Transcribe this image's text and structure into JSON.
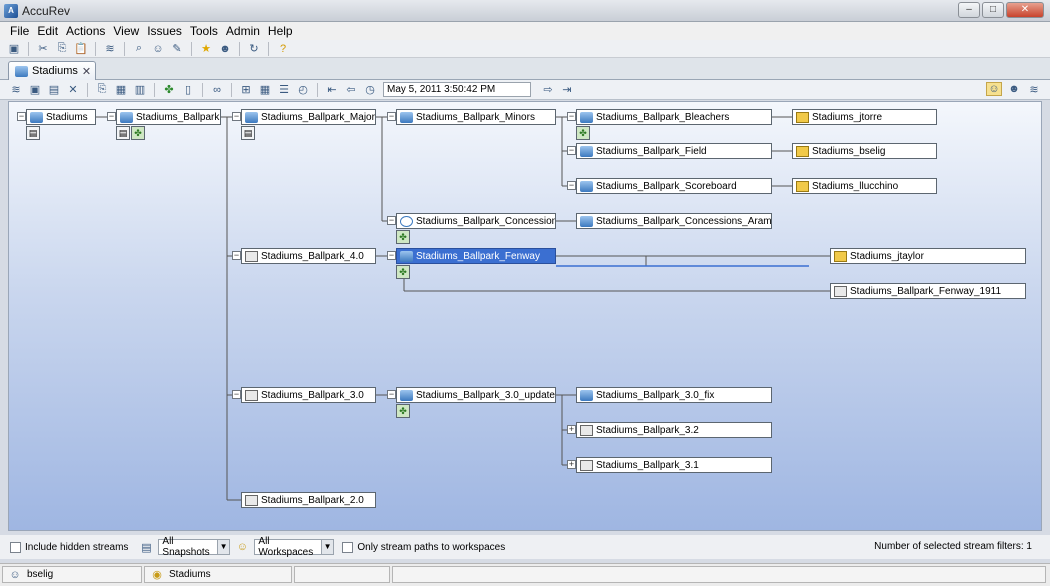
{
  "window": {
    "title": "AccuRev",
    "min_label": "–",
    "max_label": "□",
    "close_label": "✕"
  },
  "menu": {
    "items": [
      "File",
      "Edit",
      "Actions",
      "View",
      "Issues",
      "Tools",
      "Admin",
      "Help"
    ]
  },
  "tab": {
    "label": "Stadiums"
  },
  "toolbar": {
    "time_basis": "May 5, 2011 3:50:42 PM"
  },
  "streams": {
    "root": "Stadiums",
    "ballpark": "Stadiums_Ballpark",
    "majors": "Stadiums_Ballpark_Majors",
    "minors": "Stadiums_Ballpark_Minors",
    "bleachers": "Stadiums_Ballpark_Bleachers",
    "field": "Stadiums_Ballpark_Field",
    "scoreboard": "Stadiums_Ballpark_Scoreboard",
    "concessions": "Stadiums_Ballpark_Concessions",
    "concessions_aramark": "Stadiums_Ballpark_Concessions_Aramark",
    "v4": "Stadiums_Ballpark_4.0",
    "fenway": "Stadiums_Ballpark_Fenway",
    "fenway_1911": "Stadiums_Ballpark_Fenway_1911",
    "v3": "Stadiums_Ballpark_3.0",
    "v3_update": "Stadiums_Ballpark_3.0_update",
    "v3_fix": "Stadiums_Ballpark_3.0_fix",
    "v32": "Stadiums_Ballpark_3.2",
    "v31": "Stadiums_Ballpark_3.1",
    "v2": "Stadiums_Ballpark_2.0"
  },
  "workspaces": {
    "jtorre": "Stadiums_jtorre",
    "bselig": "Stadiums_bselig",
    "llucchino": "Stadiums_llucchino",
    "jtaylor": "Stadiums_jtaylor"
  },
  "filters": {
    "hidden_label": "Include hidden streams",
    "snapshots": "All Snapshots",
    "workspaces": "All Workspaces",
    "paths_label": "Only stream paths to workspaces",
    "selected_count": "Number of selected stream filters: 1"
  },
  "status": {
    "user": "bselig",
    "depot": "Stadiums"
  }
}
